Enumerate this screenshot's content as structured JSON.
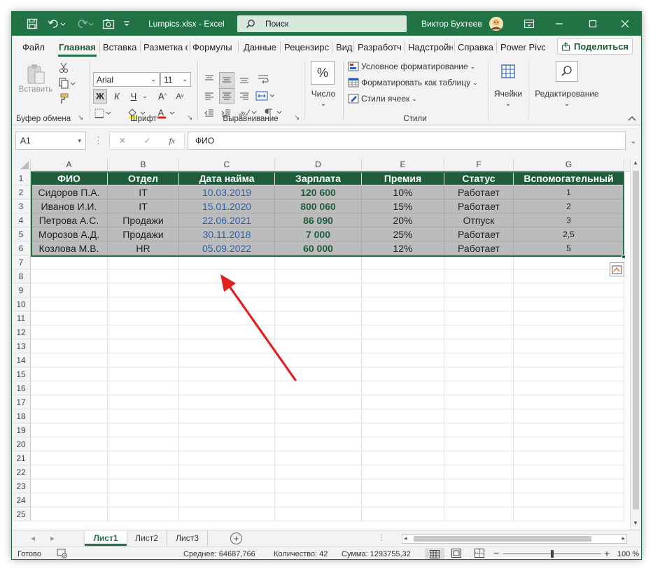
{
  "titlebar": {
    "filename": "Lumpics.xlsx  -  Excel",
    "search_label": "Поиск",
    "user_name": "Виктор Бухтеев"
  },
  "menu": {
    "tabs": [
      "Файл",
      "Главная",
      "Вставка",
      "Разметка с",
      "Формулы",
      "Данные",
      "Рецензирс",
      "Вид",
      "Разработч",
      "Надстройн",
      "Справка",
      "Power Pivc"
    ],
    "active_tab": "Главная",
    "share_label": "Поделиться"
  },
  "ribbon": {
    "clipboard": {
      "label": "Буфер обмена",
      "paste_label": "Вставить"
    },
    "font": {
      "label": "Шрифт",
      "font_name": "Arial",
      "font_size": "11",
      "bold": "Ж",
      "italic": "К",
      "underline": "Ч"
    },
    "alignment": {
      "label": "Выравнивание"
    },
    "number": {
      "label": "Число",
      "button": "Число",
      "percent": "%"
    },
    "styles": {
      "label": "Стили",
      "conditional": "Условное форматирование",
      "format_table": "Форматировать как таблицу",
      "cell_styles": "Стили ячеек"
    },
    "cells": {
      "label": "Ячейки"
    },
    "editing": {
      "label": "Редактирование"
    }
  },
  "formula_bar": {
    "name_box": "A1",
    "fx": "fx",
    "value": "ФИО"
  },
  "sheet": {
    "columns": [
      "A",
      "B",
      "C",
      "D",
      "E",
      "F",
      "G"
    ],
    "rows": [
      "1",
      "2",
      "3",
      "4",
      "5",
      "6",
      "7",
      "8",
      "9",
      "10",
      "11",
      "12",
      "13",
      "14",
      "15",
      "16",
      "17",
      "18",
      "19",
      "20",
      "21",
      "22",
      "23",
      "24",
      "25"
    ],
    "headers": [
      "ФИО",
      "Отдел",
      "Дата найма",
      "Зарплата",
      "Премия",
      "Статус",
      "Вспомогательный"
    ],
    "data": [
      [
        "Сидоров П.А.",
        "IT",
        "10.03.2019",
        "120 600",
        "10%",
        "Работает",
        "1"
      ],
      [
        "Иванов И.И.",
        "IT",
        "15.01.2020",
        "800 060",
        "15%",
        "Работает",
        "2"
      ],
      [
        "Петрова А.С.",
        "Продажи",
        "22.06.2021",
        "86 090",
        "20%",
        "Отпуск",
        "3"
      ],
      [
        "Морозов А.Д.",
        "Продажи",
        "30.11.2018",
        "7 000",
        "25%",
        "Работает",
        "2,5"
      ],
      [
        "Козлова М.В.",
        "HR",
        "05.09.2022",
        "60 000",
        "12%",
        "Работает",
        "5"
      ]
    ],
    "colors": {
      "header_bg": "#1e5c3c",
      "data_bg": "#bcbcbc",
      "date_color": "#2a62b0",
      "salary_color": "#1e5c3c",
      "arrow_color": "#e02020",
      "accent": "#217346"
    }
  },
  "sheet_tabs": {
    "tabs": [
      "Лист1",
      "Лист2",
      "Лист3"
    ],
    "active": "Лист1"
  },
  "status": {
    "ready": "Готово",
    "average": "Среднее: 64687,766",
    "count": "Количество: 42",
    "sum": "Сумма: 1293755,32",
    "zoom": "100 %"
  }
}
